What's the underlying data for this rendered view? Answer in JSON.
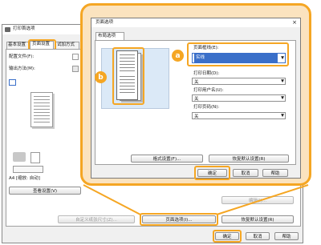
{
  "outer_dialog": {
    "title": "打印首选项",
    "tabs": [
      "基本设置",
      "页面设置",
      "试加方式"
    ],
    "active_tab": "页面设置",
    "config_file_label": "配置文件(F):",
    "output_method_label": "输出方法(M):",
    "paper_info": "A4 [缩放: 自动]",
    "view_settings_button": "查看设置(V)",
    "edit_button": "编辑(I)...",
    "custom_paper_button": "自定义纸张尺寸(Z)...",
    "page_options_button": "页面选项(I)...",
    "restore_defaults_button": "恢复默认设置(R)",
    "ok_button": "确定",
    "cancel_button": "取消",
    "help_button": "帮助"
  },
  "page_options_dialog": {
    "title": "页面选项",
    "tab": "布局选项",
    "page_border_label": "页面框线(E):",
    "page_border_value": "实线",
    "print_date_label": "打印日期(D):",
    "print_date_value": "关",
    "print_user_label": "打印用户名(U):",
    "print_user_value": "关",
    "print_page_label": "打印页码(N):",
    "print_page_value": "关",
    "format_settings_button": "格式设置(F)...",
    "restore_defaults_button": "恢复默认设置(R)",
    "ok_button": "确定",
    "cancel_button": "取消",
    "help_button": "帮助"
  },
  "callouts": {
    "a": "a",
    "b": "b"
  },
  "colors": {
    "highlight": "#f5a623",
    "selected_value_bg": "#3a6fc9",
    "preview_bg": "#dbe9f7"
  }
}
